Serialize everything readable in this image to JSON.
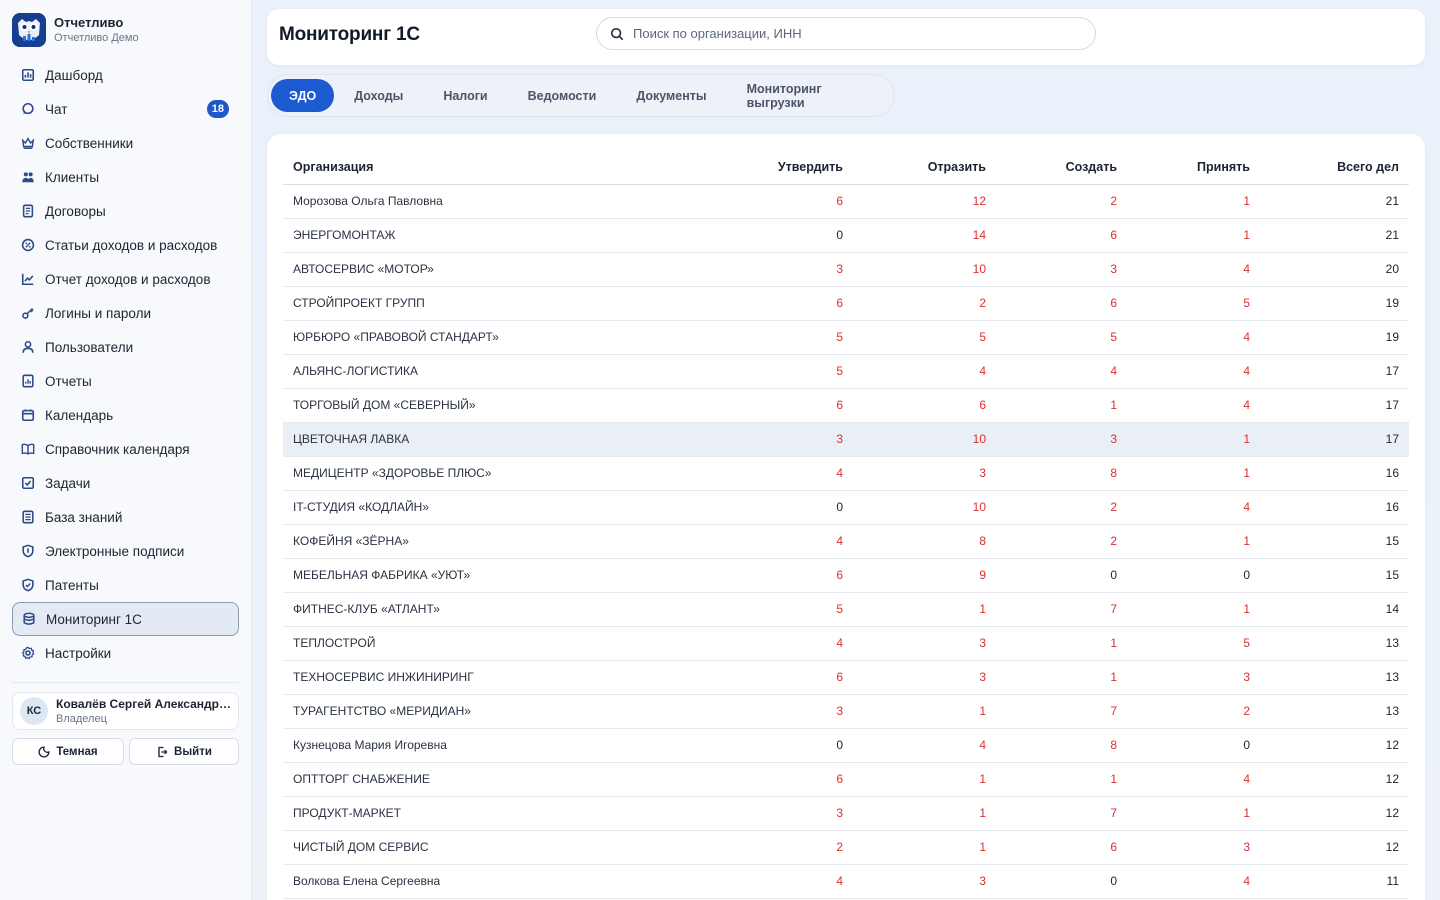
{
  "brand": {
    "title": "Отчетливо",
    "subtitle": "Отчетливо Демо"
  },
  "sidebar": {
    "items": [
      {
        "label": "Дашборд",
        "icon": "dashboard-icon"
      },
      {
        "label": "Чат",
        "icon": "chat-icon",
        "badge": "18"
      },
      {
        "label": "Собственники",
        "icon": "crown-icon"
      },
      {
        "label": "Клиенты",
        "icon": "users-icon"
      },
      {
        "label": "Договоры",
        "icon": "contract-icon"
      },
      {
        "label": "Статьи доходов и расходов",
        "icon": "percent-icon"
      },
      {
        "label": "Отчет доходов и расходов",
        "icon": "chart-line-icon"
      },
      {
        "label": "Логины и пароли",
        "icon": "key-icon"
      },
      {
        "label": "Пользователи",
        "icon": "user-icon"
      },
      {
        "label": "Отчеты",
        "icon": "report-icon"
      },
      {
        "label": "Календарь",
        "icon": "calendar-icon"
      },
      {
        "label": "Справочник календаря",
        "icon": "book-icon"
      },
      {
        "label": "Задачи",
        "icon": "checkbox-icon"
      },
      {
        "label": "База знаний",
        "icon": "knowledge-icon"
      },
      {
        "label": "Электронные подписи",
        "icon": "shield-icon"
      },
      {
        "label": "Патенты",
        "icon": "shield-check-icon"
      },
      {
        "label": "Мониторинг 1С",
        "icon": "database-icon",
        "active": true
      },
      {
        "label": "Настройки",
        "icon": "gear-icon"
      }
    ]
  },
  "user": {
    "initials": "КС",
    "name": "Ковалёв Сергей Александрович",
    "role": "Владелец"
  },
  "buttons": {
    "theme": "Темная",
    "logout": "Выйти"
  },
  "header": {
    "title": "Мониторинг 1С",
    "search_placeholder": "Поиск по организации, ИНН"
  },
  "tabs": [
    {
      "label": "ЭДО",
      "active": true
    },
    {
      "label": "Доходы"
    },
    {
      "label": "Налоги"
    },
    {
      "label": "Ведомости"
    },
    {
      "label": "Документы"
    },
    {
      "label": "Мониторинг выгрузки"
    }
  ],
  "table": {
    "columns": [
      "Организация",
      "Утвердить",
      "Отразить",
      "Создать",
      "Принять",
      "Всего дел"
    ],
    "highlighted_row": 7,
    "rows": [
      [
        "Морозова Ольга Павловна",
        "6",
        "12",
        "2",
        "1",
        "21"
      ],
      [
        "ЭНЕРГОМОНТАЖ",
        "0",
        "14",
        "6",
        "1",
        "21"
      ],
      [
        "АВТОСЕРВИС «МОТОР»",
        "3",
        "10",
        "3",
        "4",
        "20"
      ],
      [
        "СТРОЙПРОЕКТ ГРУПП",
        "6",
        "2",
        "6",
        "5",
        "19"
      ],
      [
        "ЮРБЮРО «ПРАВОВОЙ СТАНДАРТ»",
        "5",
        "5",
        "5",
        "4",
        "19"
      ],
      [
        "АЛЬЯНС-ЛОГИСТИКА",
        "5",
        "4",
        "4",
        "4",
        "17"
      ],
      [
        "ТОРГОВЫЙ ДОМ «СЕВЕРНЫЙ»",
        "6",
        "6",
        "1",
        "4",
        "17"
      ],
      [
        "ЦВЕТОЧНАЯ ЛАВКА",
        "3",
        "10",
        "3",
        "1",
        "17"
      ],
      [
        "МЕДИЦЕНТР «ЗДОРОВЬЕ ПЛЮС»",
        "4",
        "3",
        "8",
        "1",
        "16"
      ],
      [
        "IT-СТУДИЯ «КОДЛАЙН»",
        "0",
        "10",
        "2",
        "4",
        "16"
      ],
      [
        "КОФЕЙНЯ «ЗЁРНА»",
        "4",
        "8",
        "2",
        "1",
        "15"
      ],
      [
        "МЕБЕЛЬНАЯ ФАБРИКА «УЮТ»",
        "6",
        "9",
        "0",
        "0",
        "15"
      ],
      [
        "ФИТНЕС-КЛУБ «АТЛАНТ»",
        "5",
        "1",
        "7",
        "1",
        "14"
      ],
      [
        "ТЕПЛОСТРОЙ",
        "4",
        "3",
        "1",
        "5",
        "13"
      ],
      [
        "ТЕХНОСЕРВИС ИНЖИНИРИНГ",
        "6",
        "3",
        "1",
        "3",
        "13"
      ],
      [
        "ТУРАГЕНТСТВО «МЕРИДИАН»",
        "3",
        "1",
        "7",
        "2",
        "13"
      ],
      [
        "Кузнецова Мария Игоревна",
        "0",
        "4",
        "8",
        "0",
        "12"
      ],
      [
        "ОПТТОРГ СНАБЖЕНИЕ",
        "6",
        "1",
        "1",
        "4",
        "12"
      ],
      [
        "ПРОДУКТ-МАРКЕТ",
        "3",
        "1",
        "7",
        "1",
        "12"
      ],
      [
        "ЧИСТЫЙ ДОМ СЕРВИС",
        "2",
        "1",
        "6",
        "3",
        "12"
      ],
      [
        "Волкова Елена Сергеевна",
        "4",
        "3",
        "0",
        "4",
        "11"
      ]
    ]
  },
  "colors": {
    "accent": "#1b5ad0",
    "nonzero": "#d93030",
    "badge": "#1e57c9"
  }
}
